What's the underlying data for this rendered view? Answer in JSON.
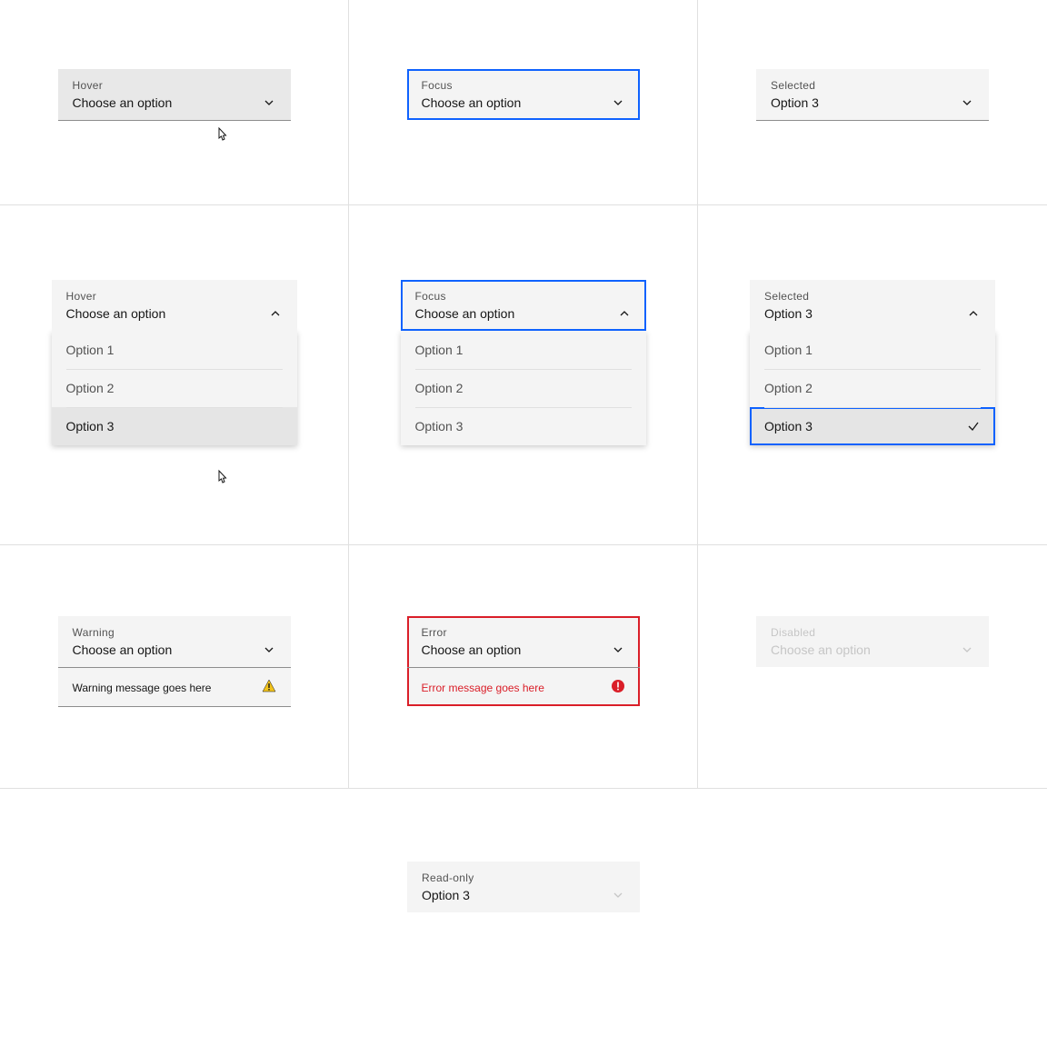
{
  "states": {
    "hover": {
      "label": "Hover",
      "value": "Choose an option"
    },
    "focus": {
      "label": "Focus",
      "value": "Choose an option"
    },
    "selected": {
      "label": "Selected",
      "value": "Option 3"
    },
    "warning": {
      "label": "Warning",
      "value": "Choose an option",
      "message": "Warning message goes here"
    },
    "error": {
      "label": "Error",
      "value": "Choose an option",
      "message": "Error message goes here"
    },
    "disabled": {
      "label": "Disabled",
      "value": "Choose an option"
    },
    "readonly": {
      "label": "Read-only",
      "value": "Option 3"
    }
  },
  "options": [
    "Option 1",
    "Option 2",
    "Option 3"
  ],
  "colors": {
    "focus": "#0f62fe",
    "error": "#da1e28",
    "warning": "#f1c21b",
    "field": "#f4f4f4"
  }
}
